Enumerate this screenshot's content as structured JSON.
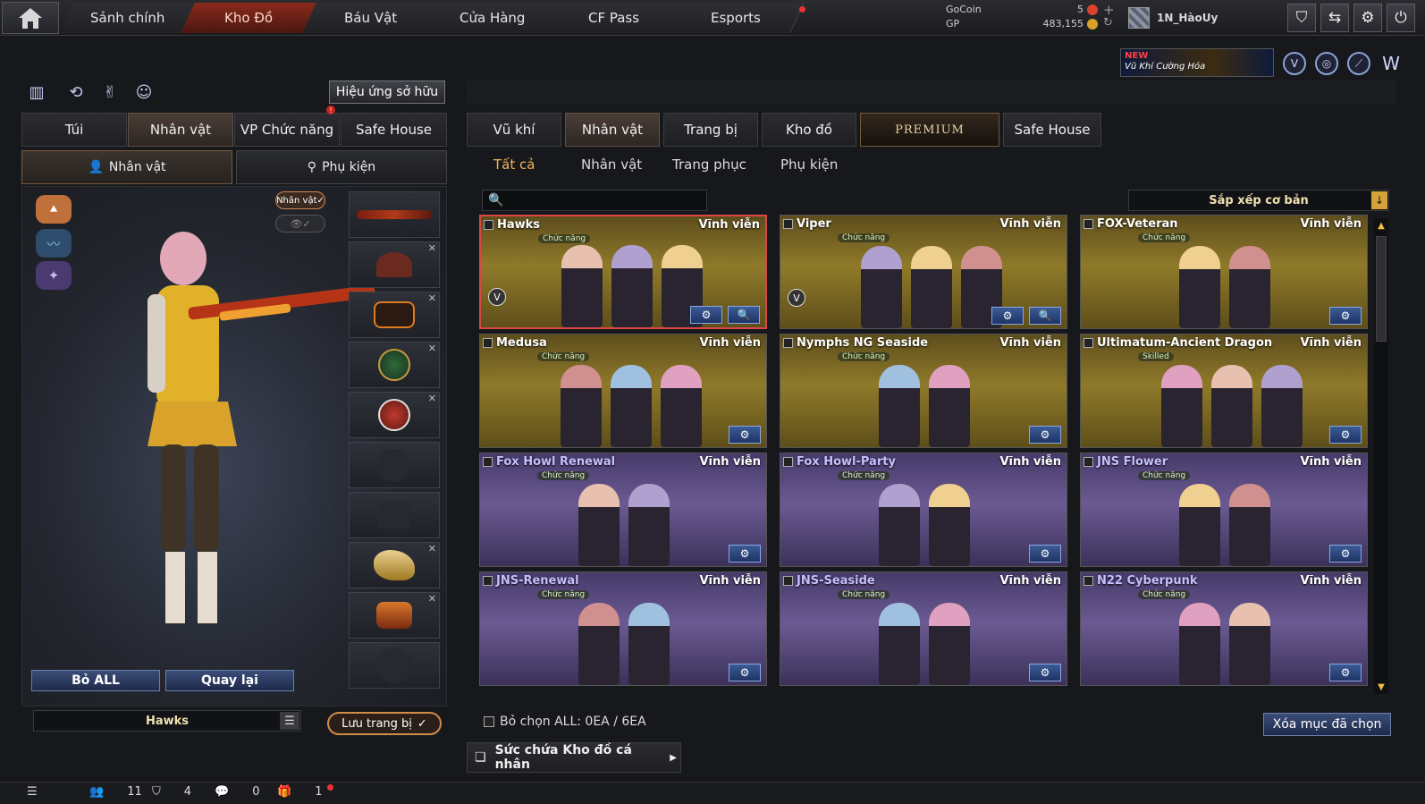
{
  "nav": {
    "tabs": [
      {
        "label": "Sảnh chính",
        "active": false
      },
      {
        "label": "Kho Đồ",
        "active": true
      },
      {
        "label": "Báu Vật",
        "active": false
      },
      {
        "label": "Cửa Hàng",
        "active": false
      },
      {
        "label": "CF Pass",
        "active": false
      },
      {
        "label": "Esports",
        "active": false,
        "notification": true
      }
    ]
  },
  "currency": {
    "gocoin_label": "GoCoin",
    "gocoin_value": "5",
    "gp_label": "GP",
    "gp_value": "483,155"
  },
  "user": {
    "name": "1N_HàoUy"
  },
  "top_icons": [
    "rank-shield-icon",
    "switch-icon",
    "settings-icon",
    "power-icon"
  ],
  "promo": {
    "badge": "NEW",
    "title": "Vũ Khí Cường Hóa"
  },
  "promo_icons": [
    "v-emblem-icon",
    "target-emblem-icon",
    "slash-emblem-icon",
    "w-emblem-icon"
  ],
  "left": {
    "effects_button": "Hiệu ứng sở hữu",
    "tabs": [
      {
        "label": "Túi",
        "active": false
      },
      {
        "label": "Nhân vật",
        "active": true
      },
      {
        "label": "VP Chức năng",
        "active": false,
        "alert": "!"
      },
      {
        "label": "Safe House",
        "active": false
      }
    ],
    "subtabs": [
      {
        "label": "Nhân vật",
        "active": true
      },
      {
        "label": "Phụ kiện",
        "active": false
      }
    ],
    "character_badge": "Nhân vật",
    "buttons": {
      "remove_all": "Bỏ ALL",
      "back": "Quay lại"
    },
    "preset_name": "Hawks",
    "save_button": "Lưu trang bị"
  },
  "right": {
    "tabs": [
      {
        "label": "Vũ khí",
        "active": false
      },
      {
        "label": "Nhân vật",
        "active": true
      },
      {
        "label": "Trang bị",
        "active": false
      },
      {
        "label": "Kho đồ",
        "active": false
      },
      {
        "label": "PREMIUM",
        "active": false,
        "premium": true
      },
      {
        "label": "Safe House",
        "active": false
      }
    ],
    "filters": [
      {
        "label": "Tất cả",
        "active": true
      },
      {
        "label": "Nhân vật",
        "active": false
      },
      {
        "label": "Trang phục",
        "active": false
      },
      {
        "label": "Phụ kiện",
        "active": false
      }
    ],
    "search_placeholder": "",
    "sort_label": "Sắp xếp cơ bản",
    "items": [
      {
        "name": "Hawks",
        "duration": "Vĩnh viễn",
        "tag": "Chức năng",
        "color": "gold",
        "selected": true,
        "figures": 3,
        "v_badge": true,
        "search_btn": true
      },
      {
        "name": "Viper",
        "duration": "Vĩnh viễn",
        "tag": "Chức năng",
        "color": "gold",
        "selected": false,
        "figures": 3,
        "v_badge": true,
        "search_btn": true
      },
      {
        "name": "FOX-Veteran",
        "duration": "Vĩnh viễn",
        "tag": "Chức năng",
        "color": "gold",
        "selected": false,
        "figures": 2,
        "v_badge": false,
        "search_btn": false
      },
      {
        "name": "Medusa",
        "duration": "Vĩnh viễn",
        "tag": "Chức năng",
        "color": "gold",
        "selected": false,
        "figures": 3,
        "v_badge": false,
        "search_btn": false
      },
      {
        "name": "Nymphs NG Seaside",
        "duration": "Vĩnh viễn",
        "tag": "Chức năng",
        "color": "gold",
        "selected": false,
        "figures": 2,
        "v_badge": false,
        "search_btn": false
      },
      {
        "name": "Ultimatum-Ancient Dragon",
        "duration": "Vĩnh viễn",
        "tag": "Skilled",
        "color": "gold",
        "selected": false,
        "figures": 3,
        "v_badge": false,
        "search_btn": false
      },
      {
        "name": "Fox Howl Renewal",
        "duration": "Vĩnh viễn",
        "tag": "Chức năng",
        "color": "purple",
        "selected": false,
        "figures": 2,
        "v_badge": false,
        "search_btn": false
      },
      {
        "name": "Fox Howl-Party",
        "duration": "Vĩnh viễn",
        "tag": "Chức năng",
        "color": "purple",
        "selected": false,
        "figures": 2,
        "v_badge": false,
        "search_btn": false
      },
      {
        "name": "JNS Flower",
        "duration": "Vĩnh viễn",
        "tag": "Chức năng",
        "color": "purple",
        "selected": false,
        "figures": 2,
        "v_badge": false,
        "search_btn": false
      },
      {
        "name": "JNS-Renewal",
        "duration": "Vĩnh viễn",
        "tag": "Chức năng",
        "color": "purple",
        "selected": false,
        "figures": 2,
        "v_badge": false,
        "search_btn": false
      },
      {
        "name": "JNS-Seaside",
        "duration": "Vĩnh viễn",
        "tag": "Chức năng",
        "color": "purple",
        "selected": false,
        "figures": 2,
        "v_badge": false,
        "search_btn": false
      },
      {
        "name": "N22 Cyberpunk",
        "duration": "Vĩnh viễn",
        "tag": "Chức năng",
        "color": "purple",
        "selected": false,
        "figures": 2,
        "v_badge": false,
        "search_btn": false
      }
    ],
    "deselect_info": "Bỏ chọn ALL: 0EA / 6EA",
    "clear_button": "Xóa mục đã chọn",
    "storage_label": "Sức chứa Kho đồ cá nhân"
  },
  "bottom": {
    "stats": [
      {
        "icon": "friends-icon",
        "value": "11"
      },
      {
        "icon": "clan-shield-icon",
        "value": "4"
      },
      {
        "icon": "chat-icon",
        "value": "0"
      },
      {
        "icon": "gift-icon",
        "value": "1"
      }
    ]
  },
  "colors": {
    "accent_orange": "#f3b25a",
    "active_nav": "#8a2a1c",
    "gold_card": "#8f7a2a",
    "purple_card": "#6b5a92",
    "button_blue": "#3a4d78"
  }
}
